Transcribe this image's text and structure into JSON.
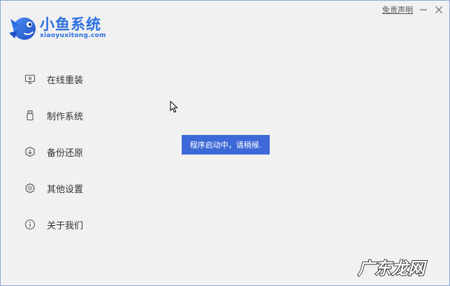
{
  "brand": {
    "name": "小鱼系统",
    "site": "xiaoyuxitong.com",
    "color": "#2c6fe0"
  },
  "titlebar": {
    "disclaimer_label": "免责声明",
    "minimize_icon": "minimize-icon",
    "close_icon": "close-icon"
  },
  "sidebar": {
    "items": [
      {
        "label": "在线重装",
        "icon": "monitor-icon"
      },
      {
        "label": "制作系统",
        "icon": "usb-drive-icon"
      },
      {
        "label": "备份还原",
        "icon": "backup-restore-icon"
      },
      {
        "label": "其他设置",
        "icon": "gear-icon"
      },
      {
        "label": "关于我们",
        "icon": "info-icon"
      }
    ]
  },
  "toast": {
    "message": "程序启动中，请稍候.",
    "color": "#3d69d8"
  },
  "watermark": {
    "text": "广东龙网"
  }
}
